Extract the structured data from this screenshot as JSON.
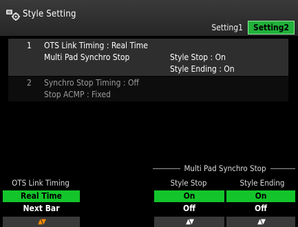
{
  "title": "Style Setting",
  "tabs": [
    {
      "label": "Setting1",
      "active": false
    },
    {
      "label": "Setting2",
      "active": true
    }
  ],
  "list": {
    "item1": {
      "number": "1",
      "ots_link_timing": "OTS Link Timing : Real Time",
      "multi_pad_synchro_stop": "Multi Pad Synchro Stop",
      "style_stop": "Style Stop : On",
      "style_ending": "Style Ending : On"
    },
    "item2": {
      "number": "2",
      "synchro_stop_timing": "Synchro Stop Timing : Off",
      "stop_acmp": "Stop ACMP : Fixed"
    }
  },
  "bottom": {
    "group_label": "Multi Pad Synchro Stop",
    "columns": [
      {
        "header": "OTS Link Timing",
        "options": [
          "Real Time",
          "Next Bar"
        ],
        "selected": 0
      },
      {
        "header": "Style Stop",
        "options": [
          "On",
          "Off"
        ],
        "selected": 0
      },
      {
        "header": "Style Ending",
        "options": [
          "On",
          "Off"
        ],
        "selected": 0
      }
    ],
    "arrow_up": "▲",
    "arrow_down": "▼"
  },
  "colors": {
    "selected_green": "#13c52b",
    "tab_green": "#21b13a",
    "arrow_orange": "#ff8a00"
  },
  "icons": {
    "title": "style-setting-icon"
  }
}
